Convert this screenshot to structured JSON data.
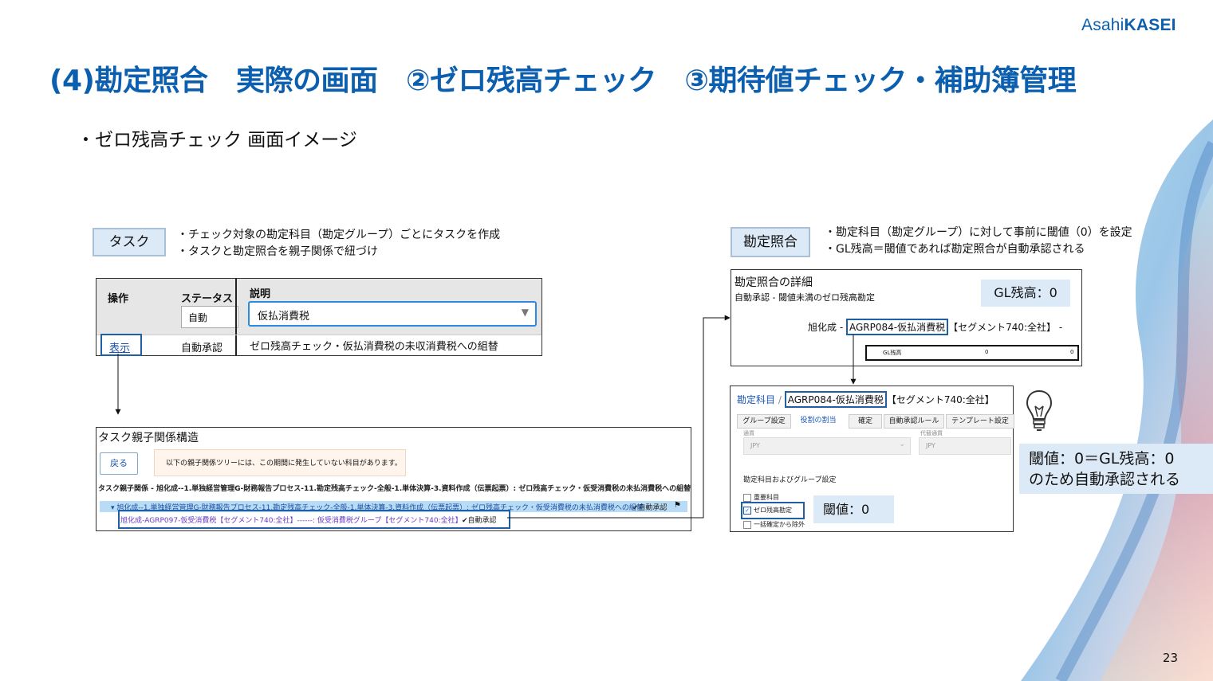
{
  "logo": {
    "prefix": "Asahi",
    "brand": "KASEI"
  },
  "title": "(4)勘定照合　実際の画面　②ゼロ残高チェック　③期待値チェック・補助簿管理",
  "subtitle": "・ゼロ残高チェック 画面イメージ",
  "task_label": "タスク",
  "task_notes": [
    "・チェック対象の勘定科目（勘定グループ）ごとにタスクを作成",
    "・タスクと勘定照合を親子関係で紐づけ"
  ],
  "recon_label": "勘定照合",
  "recon_notes": [
    "・勘定科目（勘定グループ）に対して事前に閾値（0）を設定",
    "・GL残高＝閾値であれば勘定照合が自動承認される"
  ],
  "task_table": {
    "col_action": "操作",
    "col_status": "ステータス",
    "col_desc": "説明",
    "status_filter": "自動",
    "desc_filter": "仮払消費税",
    "row_link": "表示",
    "row_status": "自動承認",
    "row_desc": "ゼロ残高チェック・仮払消費税の未収消費税への組替"
  },
  "tree": {
    "title": "タスク親子関係構造",
    "back_button": "戻る",
    "notice": "以下の親子関係ツリーには、この期間に発生していない科目があります。",
    "path": "タスク親子関係 - 旭化成--1.単独経営管理G-財務報告プロセス-11.勘定残高チェック-全般-1.単体決算-3.資料作成（伝票起票）: ゼロ残高チェック・仮受消費税の未払消費税への組替",
    "parent_row": "▾ 旭化成--1.単独経営管理G-財務報告プロセス-11.勘定残高チェック-全般-1.単体決算-3.資料作成（伝票起票）: ゼロ残高チェック・仮受消費税の未払消費税への組替",
    "parent_status": "✔自動承認",
    "child_row": "旭化成-AGRP097-仮受消費税【セグメント740:全社】------: 仮受消費税グループ【セグメント740:全社】",
    "child_status": "✔自動承認"
  },
  "recon_detail": {
    "title": "勘定照合の詳細",
    "subtitle": "自動承認 - 閾値未満のゼロ残高勘定",
    "account_prefix": "旭化成 -",
    "account_code": "AGRP084-仮払消費税",
    "account_suffix": "【セグメント740:全社】 -",
    "gl_label": "GL残高",
    "gl_value1": "0",
    "gl_value2": "0"
  },
  "gl_callout": "GL残高：0",
  "profile": {
    "breadcrumb_root": "勘定科目",
    "breadcrumb_sep": "/",
    "account_code": "AGRP084-仮払消費税",
    "account_suffix": "【セグメント740:全社】",
    "tabs": [
      "グループ設定",
      "役割の割当",
      "確定",
      "自動承認ルール",
      "テンプレート設定"
    ],
    "currency_label1": "通貨",
    "currency_label2": "代替通貨",
    "currency1": "JPY",
    "currency2": "JPY",
    "section": "勘定科目およびグループ設定",
    "check1": "重要科目",
    "check2": "ゼロ残高勘定",
    "check3": "一括確定から除外"
  },
  "threshold_callout": "閾値：0",
  "result_callout": [
    "閾値：0＝GL残高：0",
    "のため自動承認される"
  ],
  "page_number": "23",
  "colors": {
    "brand": "#0b5fae",
    "highlight": "#1f5fa6",
    "callout_bg": "#dce9f6"
  }
}
